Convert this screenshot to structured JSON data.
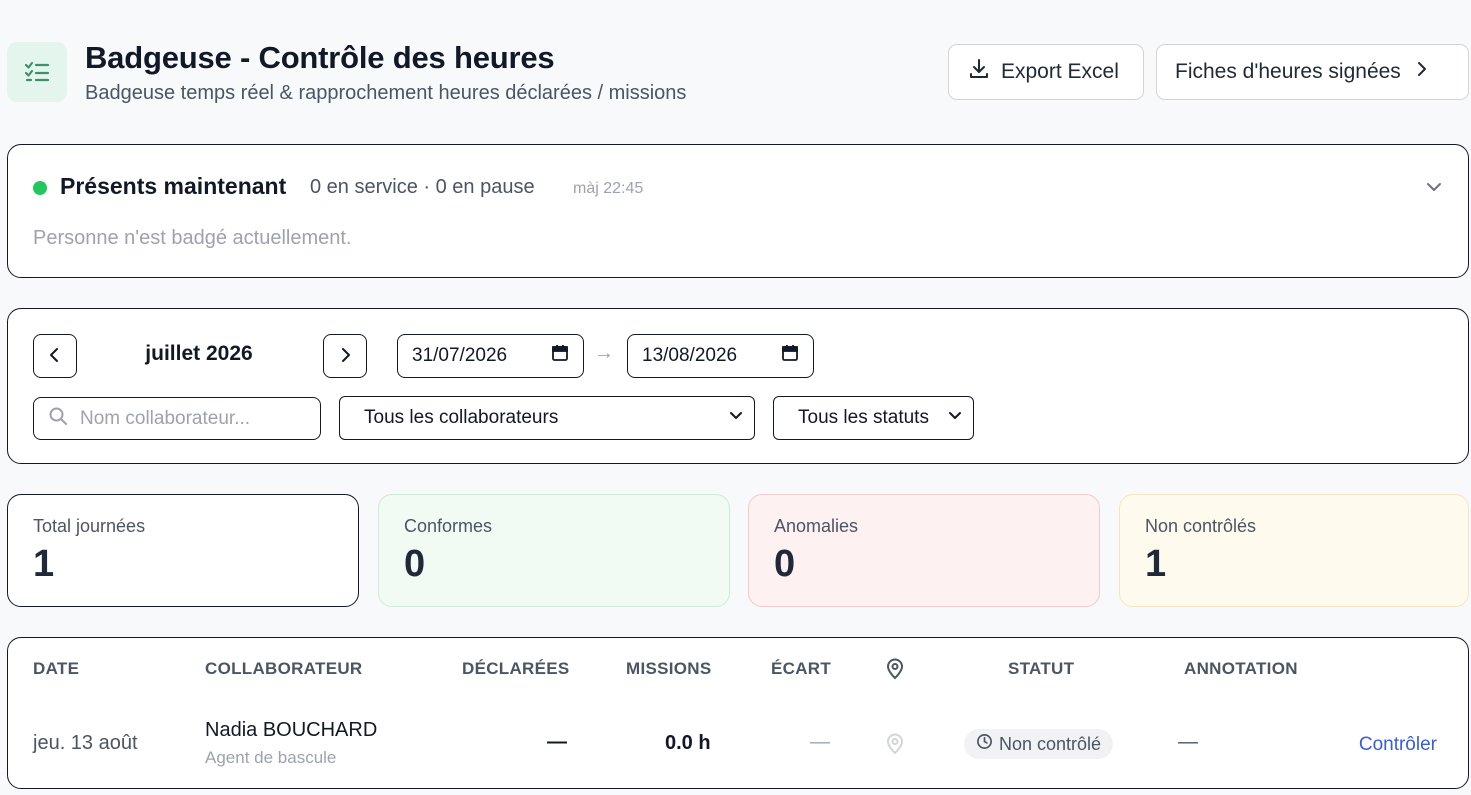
{
  "header": {
    "title": "Badgeuse - Contrôle des heures",
    "subtitle": "Badgeuse temps réel & rapprochement heures déclarées / missions",
    "export_label": "Export Excel",
    "sheets_label": "Fiches d'heures signées"
  },
  "present": {
    "title": "Présents maintenant",
    "counts": "0 en service · 0 en pause",
    "updated": "màj 22:45",
    "empty": "Personne n'est badgé actuellement."
  },
  "filters": {
    "month": "juillet 2026",
    "date_from": "31/07/2026",
    "date_to": "13/08/2026",
    "arrow": "→",
    "search_placeholder": "Nom collaborateur...",
    "collaborators_select": "Tous les collaborateurs",
    "status_select": "Tous les statuts"
  },
  "stats": {
    "total": {
      "label": "Total journées",
      "value": "1"
    },
    "ok": {
      "label": "Conformes",
      "value": "0"
    },
    "anomalies": {
      "label": "Anomalies",
      "value": "0"
    },
    "unchecked": {
      "label": "Non contrôlés",
      "value": "1"
    }
  },
  "table": {
    "columns": {
      "date": "DATE",
      "collaborator": "COLLABORATEUR",
      "declared": "DÉCLARÉES",
      "missions": "MISSIONS",
      "gap": "ÉCART",
      "status": "STATUT",
      "annotation": "ANNOTATION"
    },
    "rows": [
      {
        "date": "jeu. 13 août",
        "name": "Nadia BOUCHARD",
        "role": "Agent de bascule",
        "declared": "—",
        "missions": "0.0 h",
        "gap": "—",
        "status": "Non contrôlé",
        "annotation": "—",
        "action": "Contrôler"
      }
    ]
  },
  "colors": {
    "accent_green": "#22c55e",
    "link_blue": "#3b5bdb",
    "ok_bg": "#f1fbf4",
    "anomaly_bg": "#fdf1f1",
    "unchecked_bg": "#fefaee"
  },
  "icons": [
    "checklist-icon",
    "download-icon",
    "chevron-right-icon",
    "chevron-down-icon",
    "chevron-left-icon",
    "calendar-icon",
    "search-icon",
    "location-pin-icon",
    "clock-icon"
  ]
}
